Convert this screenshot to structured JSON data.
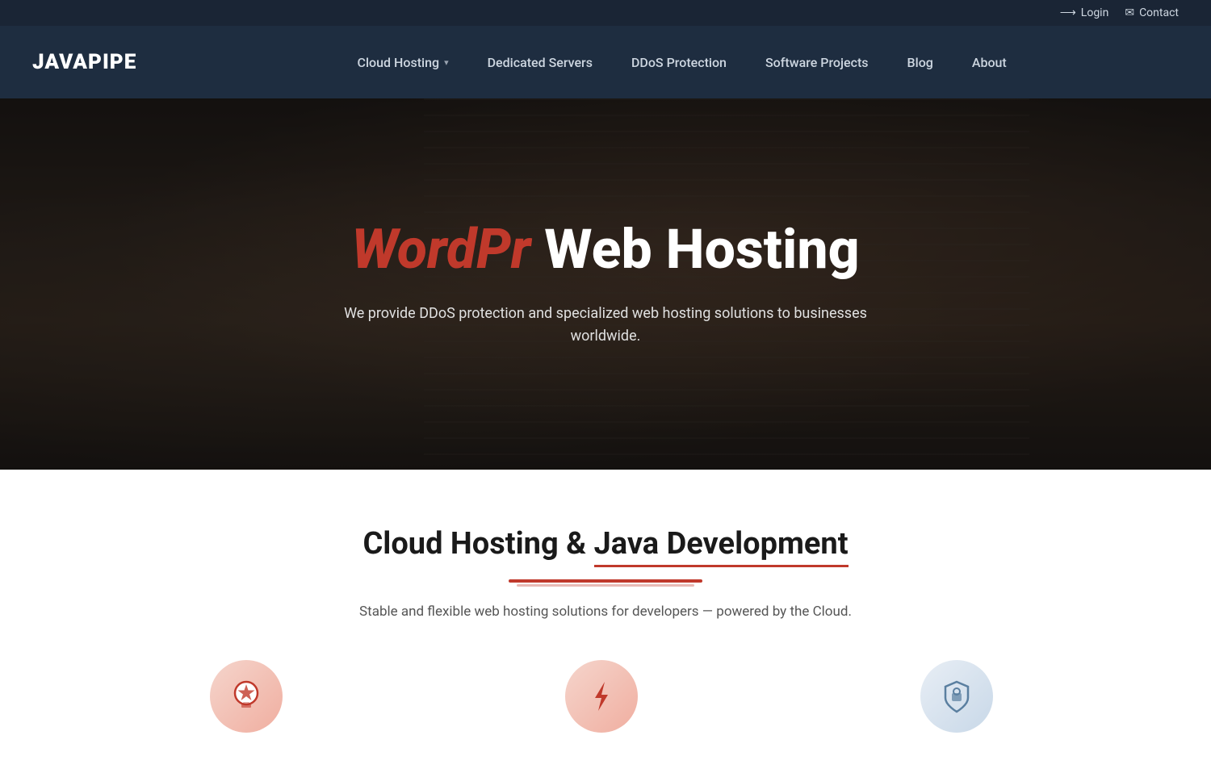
{
  "topbar": {
    "login_label": "Login",
    "contact_label": "Contact"
  },
  "header": {
    "logo": "JAVAPIPE",
    "nav": [
      {
        "id": "cloud-hosting",
        "label": "Cloud Hosting",
        "has_dropdown": true
      },
      {
        "id": "dedicated-servers",
        "label": "Dedicated Servers",
        "has_dropdown": false
      },
      {
        "id": "ddos-protection",
        "label": "DDoS Protection",
        "has_dropdown": false
      },
      {
        "id": "software-projects",
        "label": "Software Projects",
        "has_dropdown": false
      },
      {
        "id": "blog",
        "label": "Blog",
        "has_dropdown": false
      },
      {
        "id": "about",
        "label": "About",
        "has_dropdown": false
      }
    ]
  },
  "hero": {
    "title_accent": "WordPr",
    "title_main": " Web Hosting",
    "subtitle": "We provide DDoS protection and specialized web hosting solutions to businesses worldwide."
  },
  "section": {
    "title_main": "Cloud Hosting & ",
    "title_link": "Java Development",
    "subtitle": "Stable and flexible web hosting solutions for developers — powered by the Cloud.",
    "underline_decoration": true
  },
  "icons": {
    "login_icon": "→",
    "contact_icon": "✉",
    "card1_icon": "☆",
    "card2_icon": "⚡",
    "card3_icon": "🔒"
  }
}
